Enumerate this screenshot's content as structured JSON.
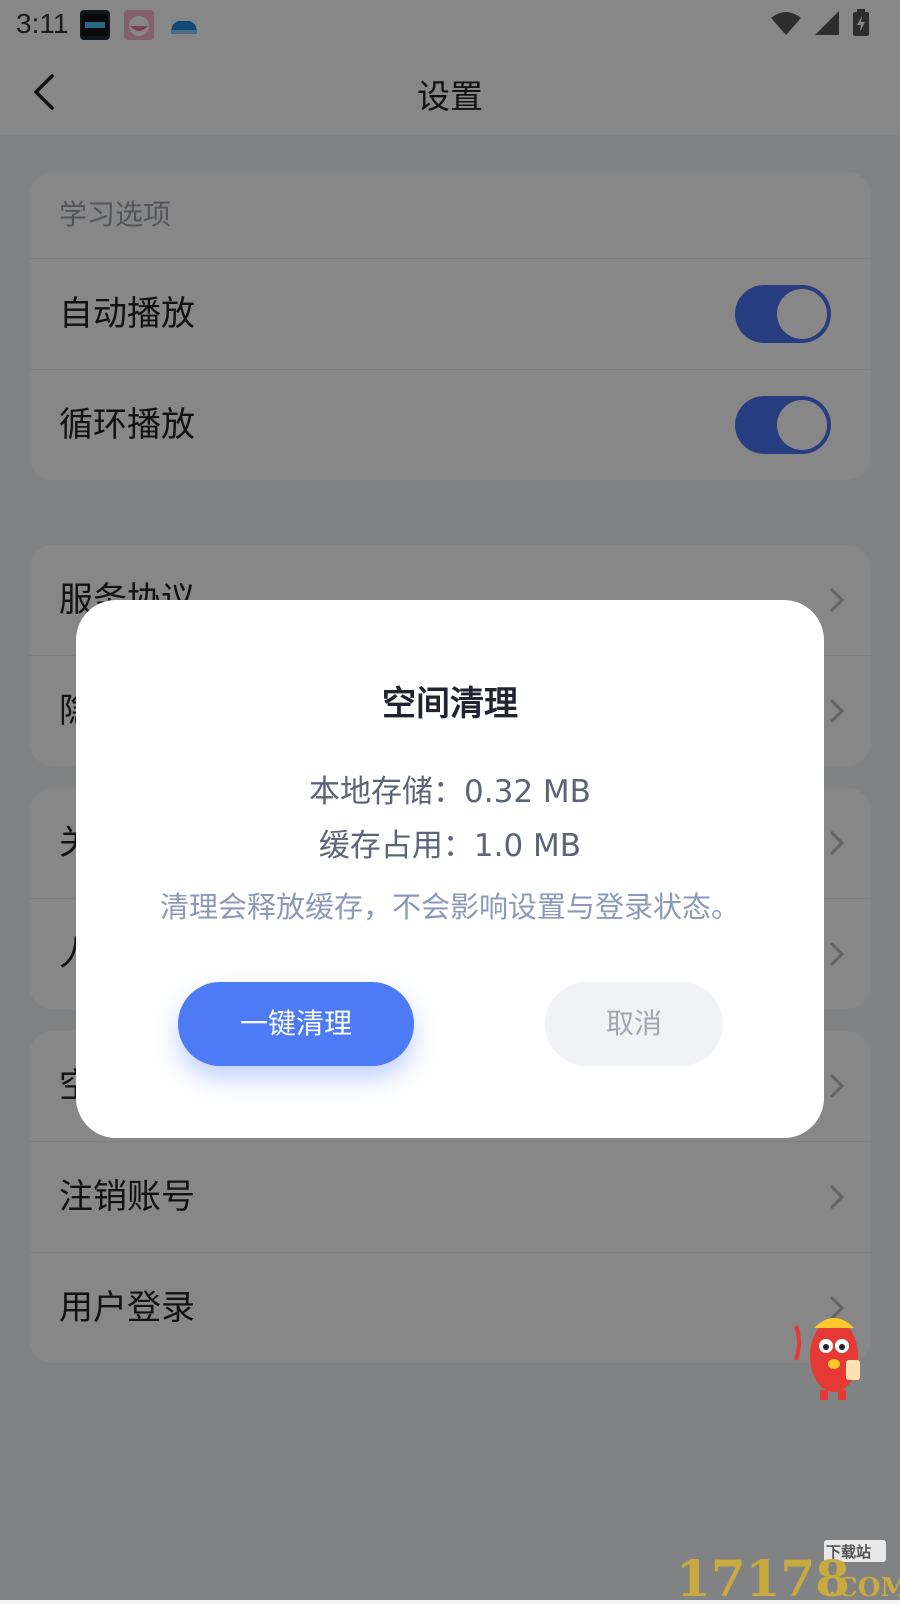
{
  "status_bar": {
    "time": "3:11",
    "app_icons": [
      "clock-widget-app-icon",
      "pink-bowl-app-icon",
      "blue-car-app-icon"
    ],
    "right_icons": [
      "wifi-icon",
      "signal-icon",
      "battery-charging-icon"
    ]
  },
  "nav": {
    "title": "设置",
    "back_icon": "chevron-left-icon"
  },
  "sections": {
    "learning": {
      "header": "学习选项",
      "items": [
        {
          "label": "自动播放",
          "toggle": true
        },
        {
          "label": "循环播放",
          "toggle": true
        }
      ]
    },
    "legal": {
      "items": [
        {
          "label": "服务协议"
        },
        {
          "label": "隐"
        }
      ]
    },
    "about": {
      "items": [
        {
          "label": "关"
        },
        {
          "label": "人"
        }
      ]
    },
    "account": {
      "items": [
        {
          "label": "空"
        },
        {
          "label": "注销账号"
        },
        {
          "label": "用户登录"
        }
      ]
    }
  },
  "dialog": {
    "title": "空间清理",
    "local_storage": "本地存储：0.32 MB",
    "cache_usage": "缓存占用：1.0 MB",
    "note": "清理会释放缓存，不会影响设置与登录状态。",
    "confirm_label": "一键清理",
    "cancel_label": "取消"
  },
  "watermark": {
    "number": "17178",
    "suffix": ".COM",
    "tag": "下载站"
  },
  "colors": {
    "accent": "#4d7af5",
    "toggle_on": "#4a73f0",
    "overlay": "rgba(0,0,0,0.47)"
  }
}
